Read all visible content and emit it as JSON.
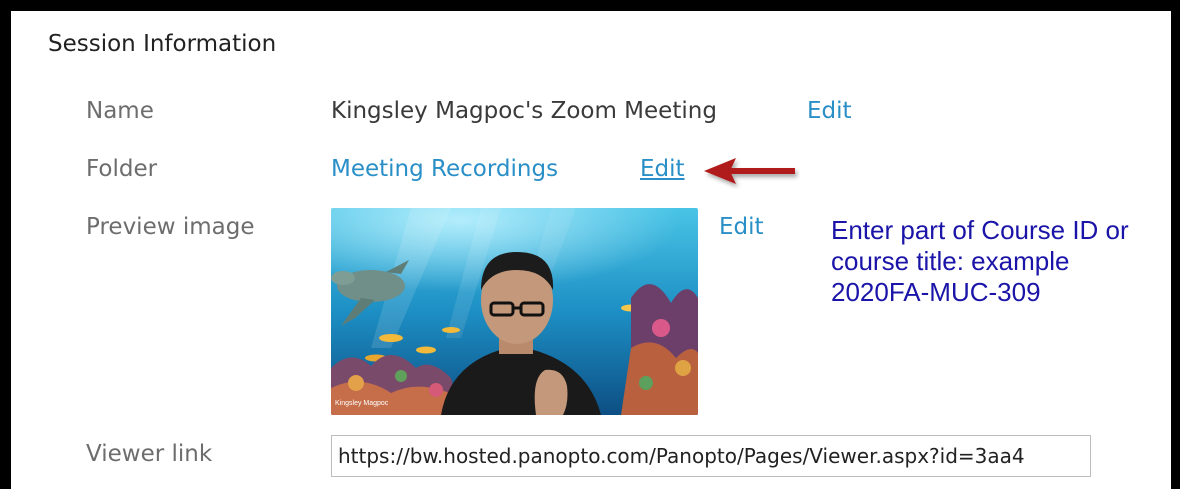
{
  "section": {
    "title": "Session Information"
  },
  "rows": {
    "name": {
      "label": "Name",
      "value": "Kingsley Magpoc's Zoom Meeting",
      "edit": "Edit"
    },
    "folder": {
      "label": "Folder",
      "value": "Meeting Recordings",
      "edit": "Edit"
    },
    "preview": {
      "label": "Preview image",
      "edit": "Edit",
      "overlay_caption": "Kingsley Magpoc"
    },
    "viewer": {
      "label": "Viewer link",
      "url": "https://bw.hosted.panopto.com/Panopto/Pages/Viewer.aspx?id=3aa4"
    }
  },
  "annotation": {
    "text": "Enter part of Course ID or course title: example 2020FA-MUC-309",
    "color": "#1a14a8"
  },
  "colors": {
    "link": "#2a8fc7",
    "label": "#6d6d6d",
    "arrow": "#b01c1c",
    "frame": "#000000"
  }
}
